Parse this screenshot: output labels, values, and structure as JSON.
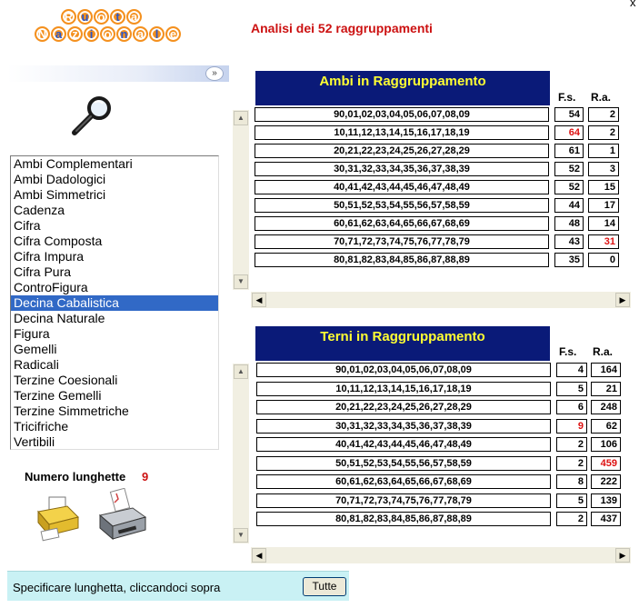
{
  "window": {
    "close_glyph": "x"
  },
  "logo": {
    "line1": [
      "R",
      "u",
      "o",
      "t",
      "a"
    ],
    "line2": [
      "N",
      "a",
      "z",
      "i",
      "o",
      "n",
      "a",
      "l",
      "e"
    ]
  },
  "page_title": "Analisi dei 52 raggruppamenti",
  "collapse_glyph": "»",
  "icons": {
    "search": "magnifier-icon",
    "print_setup": "printer-setup-icon",
    "print": "printer-icon"
  },
  "list": {
    "selected_index": 9,
    "items": [
      "Ambi Complementari",
      "Ambi Dadologici",
      "Ambi Simmetrici",
      "Cadenza",
      "Cifra",
      "Cifra Composta",
      "Cifra Impura",
      "Cifra Pura",
      "ControFigura",
      "Decina Cabalistica",
      "Decina Naturale",
      "Figura",
      "Gemelli",
      "Radicali",
      "Terzine Coesionali",
      "Terzine Gemelli",
      "Terzine Simmetriche",
      "Tricifriche",
      "Vertibili"
    ]
  },
  "numero": {
    "label": "Numero lunghette",
    "value": "9"
  },
  "status": {
    "text": "Specificare lunghetta, cliccandoci sopra",
    "button": "Tutte"
  },
  "ambi": {
    "title": "Ambi in Raggruppamento",
    "col_fs": "F.s.",
    "col_ra": "R.a.",
    "rows": [
      {
        "seq": "90,01,02,03,04,05,06,07,08,09",
        "fs": "54",
        "ra": "2"
      },
      {
        "seq": "10,11,12,13,14,15,16,17,18,19",
        "fs": "64",
        "ra": "2"
      },
      {
        "seq": "20,21,22,23,24,25,26,27,28,29",
        "fs": "61",
        "ra": "1"
      },
      {
        "seq": "30,31,32,33,34,35,36,37,38,39",
        "fs": "52",
        "ra": "3"
      },
      {
        "seq": "40,41,42,43,44,45,46,47,48,49",
        "fs": "52",
        "ra": "15"
      },
      {
        "seq": "50,51,52,53,54,55,56,57,58,59",
        "fs": "44",
        "ra": "17"
      },
      {
        "seq": "60,61,62,63,64,65,66,67,68,69",
        "fs": "48",
        "ra": "14"
      },
      {
        "seq": "70,71,72,73,74,75,76,77,78,79",
        "fs": "43",
        "ra": "31"
      },
      {
        "seq": "80,81,82,83,84,85,86,87,88,89",
        "fs": "35",
        "ra": "0"
      }
    ],
    "red_fs": [
      1
    ],
    "red_ra": [
      7
    ]
  },
  "terni": {
    "title": "Terni in Raggruppamento",
    "col_fs": "F.s.",
    "col_ra": "R.a.",
    "rows": [
      {
        "seq": "90,01,02,03,04,05,06,07,08,09",
        "fs": "4",
        "ra": "164"
      },
      {
        "seq": "10,11,12,13,14,15,16,17,18,19",
        "fs": "5",
        "ra": "21"
      },
      {
        "seq": "20,21,22,23,24,25,26,27,28,29",
        "fs": "6",
        "ra": "248"
      },
      {
        "seq": "30,31,32,33,34,35,36,37,38,39",
        "fs": "9",
        "ra": "62"
      },
      {
        "seq": "40,41,42,43,44,45,46,47,48,49",
        "fs": "2",
        "ra": "106"
      },
      {
        "seq": "50,51,52,53,54,55,56,57,58,59",
        "fs": "2",
        "ra": "459"
      },
      {
        "seq": "60,61,62,63,64,65,66,67,68,69",
        "fs": "8",
        "ra": "222"
      },
      {
        "seq": "70,71,72,73,74,75,76,77,78,79",
        "fs": "5",
        "ra": "139"
      },
      {
        "seq": "80,81,82,83,84,85,86,87,88,89",
        "fs": "2",
        "ra": "437"
      }
    ],
    "red_fs": [
      3
    ],
    "red_ra": [
      5
    ]
  },
  "colors": {
    "title_bar_bg": "#0a1a78",
    "title_bar_text": "#ffff33",
    "accent_red": "#cc1111",
    "selection": "#3169c6",
    "status_bg": "#c9f1f4"
  }
}
